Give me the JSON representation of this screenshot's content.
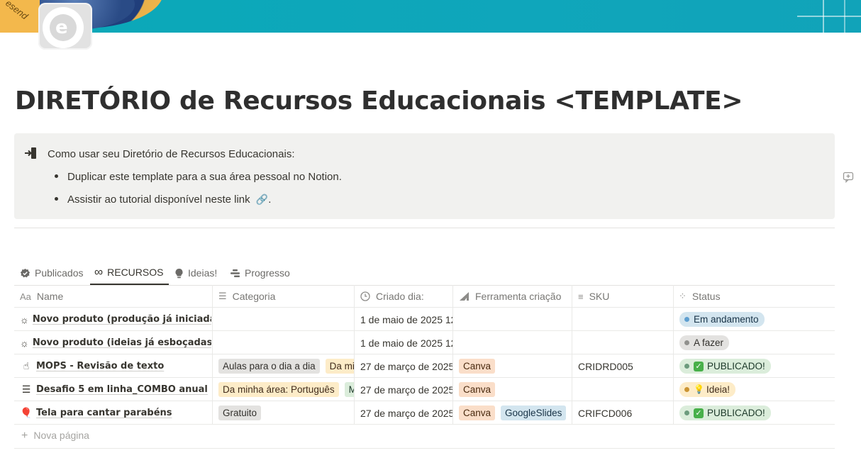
{
  "cover": {
    "ribbon_text": "esend"
  },
  "page_icon": "e",
  "title": "DIRETÓRIO de Recursos Educacionais <TEMPLATE>",
  "callout": {
    "heading": "Como usar seu Diretório de Recursos Educacionais:",
    "bullets": [
      "Duplicar este template para a sua área pessoal no Notion.",
      "Assistir ao tutorial disponível neste link"
    ],
    "link_suffix": "."
  },
  "tabs": [
    {
      "label": "Publicados",
      "icon": "badge-check-icon"
    },
    {
      "label": "RECURSOS",
      "icon": "infinity-icon",
      "active": true
    },
    {
      "label": "Ideias!",
      "icon": "lightbulb-icon"
    },
    {
      "label": "Progresso",
      "icon": "timeline-icon"
    }
  ],
  "columns": [
    {
      "label": "Name",
      "icon": "Aa"
    },
    {
      "label": "Categoria",
      "icon": "list-icon"
    },
    {
      "label": "Criado dia:",
      "icon": "clock-icon"
    },
    {
      "label": "Ferramenta criação",
      "icon": "tool-icon"
    },
    {
      "label": "SKU",
      "icon": "text-icon"
    },
    {
      "label": "Status",
      "icon": "status-icon"
    }
  ],
  "rows": [
    {
      "icon": "lightbulb-outline-icon",
      "name": "Novo produto (produção já iniciada)",
      "categoria": [],
      "criado": "1 de maio de 2025 12",
      "ferramenta": [],
      "sku": "",
      "status": {
        "label": "Em andamento",
        "color": "blue",
        "emoji": ""
      }
    },
    {
      "icon": "lightbulb-outline-icon",
      "name": "Novo produto (ideias já esboçadas)",
      "categoria": [],
      "criado": "1 de maio de 2025 12",
      "ferramenta": [],
      "sku": "",
      "status": {
        "label": "A fazer",
        "color": "gray",
        "emoji": ""
      }
    },
    {
      "icon": "hand-icon",
      "name": "MOPS - Revisão de texto",
      "categoria": [
        {
          "label": "Aulas para o dia a dia",
          "color": "gray"
        },
        {
          "label": "Da minha área: Português",
          "color": "yellow"
        }
      ],
      "criado": "27 de março de 2025",
      "ferramenta": [
        {
          "label": "Canva",
          "color": "orange"
        }
      ],
      "sku": "CRIDRD005",
      "status": {
        "label": "PUBLICADO!",
        "color": "green",
        "emoji": "check"
      }
    },
    {
      "icon": "menu-lines-icon",
      "name": "Desafio 5 em linha_COMBO anual",
      "categoria": [
        {
          "label": "Da minha área: Português",
          "color": "yellow"
        },
        {
          "label": "Matemática",
          "color": "green"
        }
      ],
      "criado": "27 de março de 2025",
      "ferramenta": [
        {
          "label": "Canva",
          "color": "orange"
        }
      ],
      "sku": "",
      "status": {
        "label": "Ideia!",
        "color": "yellow",
        "emoji": "bulb"
      }
    },
    {
      "icon": "balloon-icon",
      "name": "Tela para cantar parabéns",
      "categoria": [
        {
          "label": "Gratuito",
          "color": "gray"
        }
      ],
      "criado": "27 de março de 2025",
      "ferramenta": [
        {
          "label": "Canva",
          "color": "orange"
        },
        {
          "label": "GoogleSlides",
          "color": "blue"
        }
      ],
      "sku": "CRIFCD006",
      "status": {
        "label": "PUBLICADO!",
        "color": "green",
        "emoji": "check"
      }
    }
  ],
  "new_page_label": "Nova página"
}
